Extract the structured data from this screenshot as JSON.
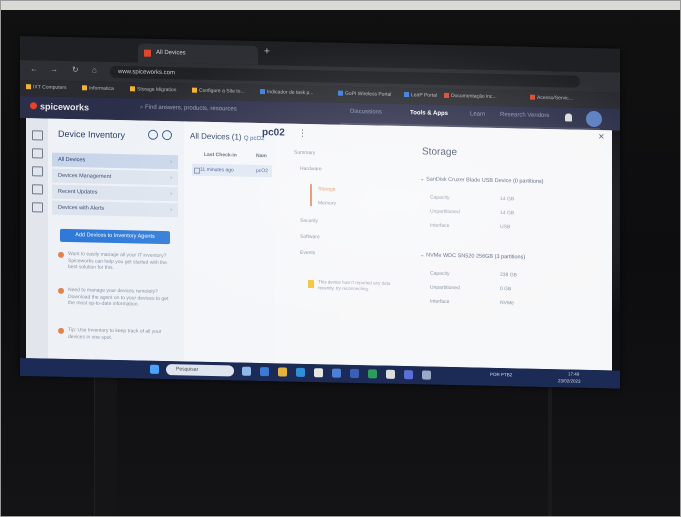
{
  "browser": {
    "tab_title": "All Devices",
    "url": "www.spiceworks.com",
    "bookmarks": [
      "IXT Computers",
      "Informatica",
      "Storage Migration",
      "Configure a Site to...",
      "Indicador de task p...",
      "GoPI Wireless Portal",
      "LeaP Portal",
      "Documentação inc...",
      "Acesso/Servic..."
    ]
  },
  "header": {
    "logo": "spiceworks",
    "search_placeholder": "Find answers, products, resources",
    "nav": [
      "Discussions",
      "Tools & Apps",
      "Learn",
      "Research Vendors"
    ],
    "active_nav": "Tools & Apps"
  },
  "inventory": {
    "title": "Device Inventory",
    "items": [
      "All Devices",
      "Devices Management",
      "Recent Updates",
      "Devices with Alerts"
    ],
    "add_button": "Add Devices to Inventory Agents",
    "tips": [
      "Want to easily manage all your IT inventory? Spiceworks can help you get started with the best solution for this.",
      "Need to manage your devices remotely? Download the agent on to your devices to get the most up-to-date information.",
      "Tip: Use Inventory to keep track of all your devices in one spot."
    ]
  },
  "devices": {
    "title": "All Devices (1)",
    "search_label": "Q pcO2",
    "col_last_checkin": "Last Check-in",
    "col_name": "Nam",
    "row_checkin": "11 minutes ago",
    "row_name": "pcO2"
  },
  "detail": {
    "device_name": "pc02",
    "menu_glyph": "⋮",
    "tree": [
      "Summary",
      "Hardware",
      "Storage",
      "Memory",
      "Security",
      "Software",
      "Events"
    ],
    "selected_tree": "Storage",
    "note": "This device hasn't reported any data recently, try reconnecting.",
    "section_title": "Storage",
    "drives": [
      {
        "name": "SanDisk Cruzer Blade USB Device (0 partitions)",
        "fields": [
          [
            "Capacity",
            "14 GB"
          ],
          [
            "Unpartitioned",
            "14 GB"
          ],
          [
            "Interface",
            "USB"
          ]
        ]
      },
      {
        "name": "NVMe WDC SN520 256GB (3 partitions)",
        "fields": [
          [
            "Capacity",
            "238 GB"
          ],
          [
            "Unpartitioned",
            "0 GB"
          ],
          [
            "Interface",
            "NVMe"
          ]
        ]
      }
    ]
  },
  "taskbar": {
    "search_label": "Pesquisar",
    "tray_time": "17:49",
    "tray_date": "23/02/2023",
    "tray_lang": "POR PTB2"
  },
  "colors": {
    "header_bg": "#2c2f49",
    "accent_orange": "#e0452d",
    "primary_blue": "#2f7ad8",
    "taskbar_bg": "#1b2b55"
  }
}
